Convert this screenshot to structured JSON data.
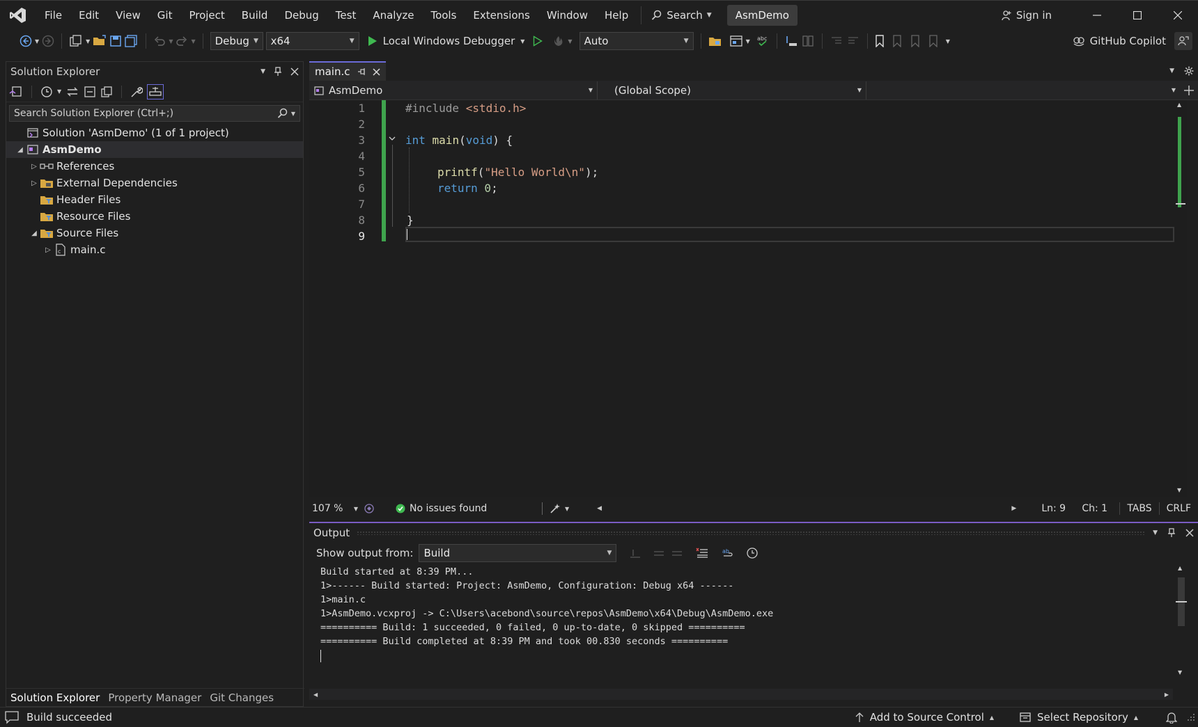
{
  "title_bar": {
    "menus": [
      "File",
      "Edit",
      "View",
      "Git",
      "Project",
      "Build",
      "Debug",
      "Test",
      "Analyze",
      "Tools",
      "Extensions",
      "Window",
      "Help"
    ],
    "search_label": "Search",
    "project_name": "AsmDemo",
    "sign_in": "Sign in"
  },
  "toolbar": {
    "configuration": "Debug",
    "platform": "x64",
    "debugger": "Local Windows Debugger",
    "auto_combo": "Auto",
    "copilot_label": "GitHub Copilot"
  },
  "solution_explorer": {
    "title": "Solution Explorer",
    "search_placeholder": "Search Solution Explorer (Ctrl+;)",
    "tree": [
      {
        "label": "Solution 'AsmDemo' (1 of 1 project)",
        "indent": 0,
        "expander": "",
        "icon": "solution-icon",
        "bold": false
      },
      {
        "label": "AsmDemo",
        "indent": 0,
        "expander": "expanded",
        "icon": "project-icon",
        "bold": true
      },
      {
        "label": "References",
        "indent": 1,
        "expander": "collapsed",
        "icon": "references-icon",
        "bold": false
      },
      {
        "label": "External Dependencies",
        "indent": 1,
        "expander": "collapsed",
        "icon": "folder-icon",
        "bold": false
      },
      {
        "label": "Header Files",
        "indent": 1,
        "expander": "",
        "icon": "filter-folder-icon",
        "bold": false
      },
      {
        "label": "Resource Files",
        "indent": 1,
        "expander": "",
        "icon": "filter-folder-icon",
        "bold": false
      },
      {
        "label": "Source Files",
        "indent": 1,
        "expander": "expanded",
        "icon": "filter-folder-icon",
        "bold": false
      },
      {
        "label": "main.c",
        "indent": 2,
        "expander": "collapsed",
        "icon": "c-file-icon",
        "bold": false
      }
    ],
    "bottom_tabs": [
      "Solution Explorer",
      "Property Manager",
      "Git Changes"
    ]
  },
  "editor": {
    "tab_name": "main.c",
    "project_scope": "AsmDemo",
    "global_scope": "(Global Scope)",
    "line_numbers": [
      "1",
      "2",
      "3",
      "4",
      "5",
      "6",
      "7",
      "8",
      "9"
    ],
    "code": {
      "l1_pp": "#include",
      "l1_hdr": " <stdio.h>",
      "l3_kw": "int",
      "l3_fn": " main",
      "l3_open": "(",
      "l3_void": "void",
      "l3_rest": ") {",
      "l5_fn": "printf",
      "l5_open": "(",
      "l5_str": "\"Hello World\\n\"",
      "l5_close": ");",
      "l6_kw": "return",
      "l6_num": " 0",
      "l6_semi": ";",
      "l8": "}"
    },
    "zoom": "107 %",
    "issues": "No issues found",
    "line": "Ln: 9",
    "char": "Ch: 1",
    "tabs_mode": "TABS",
    "line_ending": "CRLF"
  },
  "output": {
    "title": "Output",
    "show_from_label": "Show output from:",
    "source": "Build",
    "lines": [
      "Build started at 8:39 PM...",
      "1>------ Build started: Project: AsmDemo, Configuration: Debug x64 ------",
      "1>main.c",
      "1>AsmDemo.vcxproj -> C:\\Users\\acebond\\source\\repos\\AsmDemo\\x64\\Debug\\AsmDemo.exe",
      "========== Build: 1 succeeded, 0 failed, 0 up-to-date, 0 skipped ==========",
      "========== Build completed at 8:39 PM and took 00.830 seconds =========="
    ]
  },
  "status_bar": {
    "message": "Build succeeded",
    "source_control": "Add to Source Control",
    "repository": "Select Repository"
  }
}
